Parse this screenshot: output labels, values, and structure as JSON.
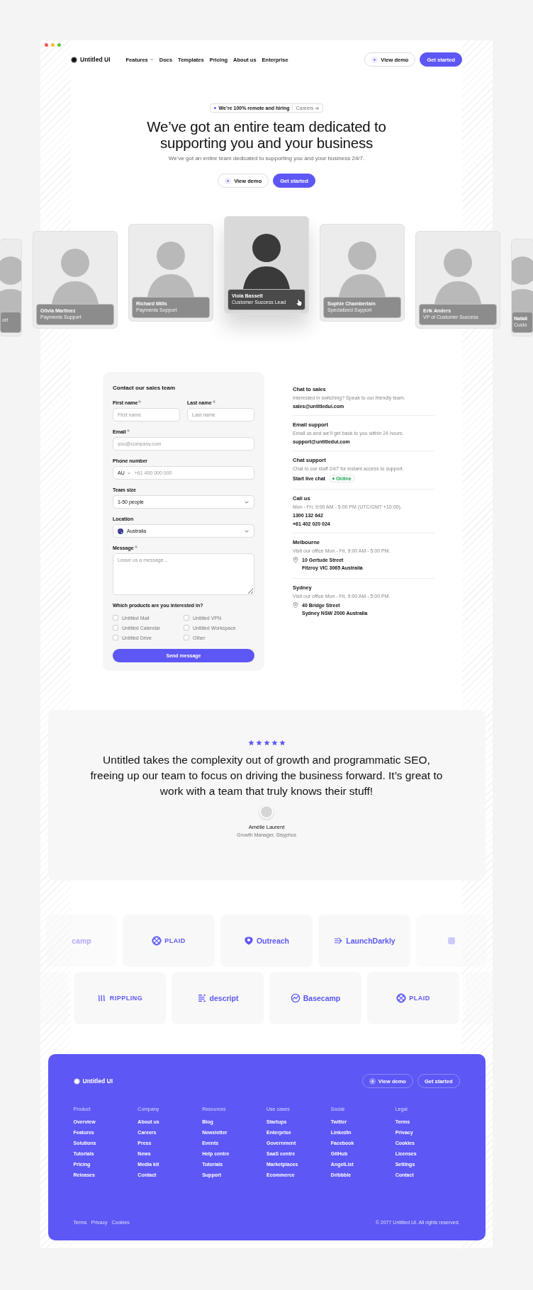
{
  "nav": {
    "logo": "Untitled UI",
    "links": [
      {
        "label": "Features",
        "dropdown": true
      },
      {
        "label": "Docs",
        "dropdown": false
      },
      {
        "label": "Templates",
        "dropdown": false
      },
      {
        "label": "Pricing",
        "dropdown": false
      },
      {
        "label": "About us",
        "dropdown": false
      },
      {
        "label": "Enterprise",
        "dropdown": false
      }
    ],
    "buttons": [
      {
        "label": "View demo",
        "kind": "secondary"
      },
      {
        "label": "Get started",
        "kind": "primary"
      }
    ]
  },
  "hero": {
    "badge": "We’re 100% remote and hiring",
    "badge_link": "Careers",
    "title": "We’ve got an entire team dedicated to supporting you and your business",
    "subtitle": "We’ve got an entire team dedicated to supporting you and your business 24/7.",
    "buttons": [
      {
        "label": "View demo",
        "kind": "secondary"
      },
      {
        "label": "Get started",
        "kind": "primary"
      }
    ]
  },
  "team": [
    {
      "kind": "edge",
      "role": "ort",
      "selected": false
    },
    {
      "kind": "full",
      "name": "Olivia Martinez",
      "role": "Payments Support",
      "selected": false
    },
    {
      "kind": "full",
      "name": "Richard Mills",
      "role": "Payments Support",
      "selected": false
    },
    {
      "kind": "full",
      "name": "Viola Bassett",
      "role": "Customer Success Lead",
      "selected": true
    },
    {
      "kind": "full",
      "name": "Sophie Chamberlain",
      "role": "Specialized Support",
      "selected": false
    },
    {
      "kind": "full",
      "name": "Erik Anders",
      "role": "VP of Customer Success",
      "selected": false
    },
    {
      "kind": "edge",
      "name": "Natali",
      "role": "Custo",
      "selected": false
    }
  ],
  "form": {
    "title": "Contact our sales team",
    "first_name": {
      "label": "First name",
      "required": true,
      "placeholder": "First name"
    },
    "last_name": {
      "label": "Last name",
      "required": true,
      "placeholder": "Last name"
    },
    "email": {
      "label": "Email",
      "required": true,
      "placeholder": "you@company.com"
    },
    "phone": {
      "label": "Phone number",
      "required": false,
      "country": "AU",
      "placeholder": "+61 400 000 000"
    },
    "team_size": {
      "label": "Team size",
      "required": false,
      "value": "1-50 people"
    },
    "location": {
      "label": "Location",
      "required": false,
      "value": "Australia"
    },
    "message": {
      "label": "Message",
      "required": true,
      "placeholder": "Leave us a message..."
    },
    "products_label": "Which products are you interested in?",
    "products": [
      {
        "label": "Untitled Mail",
        "checked": false
      },
      {
        "label": "Untitled VPN",
        "checked": false
      },
      {
        "label": "Untitled Calendar",
        "checked": false
      },
      {
        "label": "Untitled Workspace",
        "checked": false
      },
      {
        "label": "Untitled Drive",
        "checked": false
      },
      {
        "label": "Other",
        "checked": false
      }
    ],
    "submit": "Send message"
  },
  "contacts": [
    {
      "kind": "email",
      "title": "Chat to sales",
      "text": "Interested in switching? Speak to our friendly team.",
      "lines": [
        "sales@untitledui.com"
      ]
    },
    {
      "kind": "email",
      "title": "Email support",
      "text": "Email us and we’ll get back to you within 24 hours.",
      "lines": [
        "support@untitledui.com"
      ]
    },
    {
      "kind": "chat",
      "title": "Chat support",
      "text": "Chat to our staff 24/7 for instant access to support.",
      "lines": [
        "Start live chat"
      ],
      "status": "Online"
    },
    {
      "kind": "phone",
      "title": "Call us",
      "text": "Mon - Fri, 9:00 AM - 5:00 PM (UTC/GMT +10:00).",
      "lines": [
        "1300 132 642",
        "+61 402 020 024"
      ]
    },
    {
      "kind": "address",
      "title": "Melbourne",
      "text": "Visit our office Mon - Fri, 9:00 AM - 5:00 PM.",
      "lines": [
        "10 Gertude Street",
        "Fitzroy VIC 3065 Australia"
      ]
    },
    {
      "kind": "address",
      "title": "Sydney",
      "text": "Visit our office Mon - Fri, 9:00 AM - 5:00 PM.",
      "lines": [
        "40 Bridge Street",
        "Sydney NSW 2000 Australia"
      ]
    }
  ],
  "testimonial": {
    "stars": 5,
    "quote": "Untitled takes the complexity out of growth and programmatic SEO, freeing up our team to focus on driving the business forward. It’s great to work with a team that truly knows their stuff!",
    "name": "Amélie Laurent",
    "role": "Growth Manager, Sisyphus"
  },
  "logos": [
    [
      {
        "kind": "edge",
        "name": "camp"
      },
      {
        "kind": "grid",
        "name": "PLAID"
      },
      {
        "kind": "shield",
        "name": "Outreach"
      },
      {
        "kind": "arrow",
        "name": "LaunchDarkly"
      },
      {
        "kind": "faded"
      }
    ],
    [
      {
        "kind": "edge"
      },
      {
        "kind": "waves",
        "name": "RIPPLING"
      },
      {
        "kind": "lines",
        "name": "descript"
      },
      {
        "kind": "mountain",
        "name": "Basecamp"
      },
      {
        "kind": "grid",
        "name": "PLAID"
      },
      {
        "kind": "edge"
      }
    ]
  ],
  "footer": {
    "logo": "Untitled UI",
    "buttons": [
      {
        "label": "View demo",
        "kind": "secondary"
      },
      {
        "label": "Get started",
        "kind": "outline"
      }
    ],
    "columns": [
      {
        "heading": "Product",
        "links": [
          "Overview",
          "Features",
          "Solutions",
          "Tutorials",
          "Pricing",
          "Releases"
        ]
      },
      {
        "heading": "Company",
        "links": [
          "About us",
          "Careers",
          "Press",
          "News",
          "Media kit",
          "Contact"
        ]
      },
      {
        "heading": "Resources",
        "links": [
          "Blog",
          "Newsletter",
          "Events",
          "Help centre",
          "Tutorials",
          "Support"
        ]
      },
      {
        "heading": "Use cases",
        "links": [
          "Startups",
          "Enterprise",
          "Government",
          "SaaS centre",
          "Marketplaces",
          "Ecommerce"
        ]
      },
      {
        "heading": "Social",
        "links": [
          "Twitter",
          "LinkedIn",
          "Facebook",
          "GitHub",
          "AngelList",
          "Dribbble"
        ]
      },
      {
        "heading": "Legal",
        "links": [
          "Terms",
          "Privacy",
          "Cookies",
          "Licenses",
          "Settings",
          "Contact"
        ]
      }
    ],
    "bottom_links": [
      "Terms",
      "Privacy",
      "Cookies"
    ],
    "copyright": "© 2077 Untitled UI. All rights reserved."
  }
}
